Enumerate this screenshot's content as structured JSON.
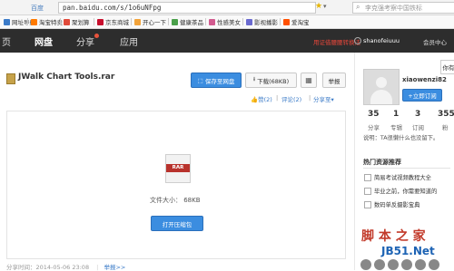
{
  "browser": {
    "brand": "百度",
    "url": "pan.baidu.com/s/1o6uNFpg",
    "search_placeholder": "李克强考察中国铁标"
  },
  "favorites": [
    {
      "label": "网址导航",
      "color": "#3b7bc8"
    },
    {
      "label": "淘宝特卖",
      "color": "#ff7a00"
    },
    {
      "label": "聚划算",
      "color": "#e04a3a"
    },
    {
      "label": "京东商城",
      "color": "#c8102e"
    },
    {
      "label": "开心一下",
      "color": "#f2a33a"
    },
    {
      "label": "健康茶品",
      "color": "#4aa04a"
    },
    {
      "label": "性感美女",
      "color": "#d25b8f"
    },
    {
      "label": "影视播影",
      "color": "#6a6ad0"
    },
    {
      "label": "爱淘宝",
      "color": "#ff5000"
    }
  ],
  "nav": {
    "home": "页",
    "pan": "网盘",
    "share": "分享",
    "apps": "应用",
    "promo": "用证借腰腰转换法",
    "user": "shanofeiuuu",
    "member": "会员中心"
  },
  "file": {
    "name": "JWalk Chart Tools.rar",
    "save_label": "保存至网盘",
    "download_label": "下载(68KB)",
    "report_label": "举报",
    "like_label": "赞(2)",
    "comment_label": "评论(2)",
    "shareto_label": "分享至",
    "size_label": "文件大小：  68KB",
    "open_label": "打开压缩包",
    "rar_text": "RAR",
    "share_time": "分享时间：2014-05-06 23:08",
    "report_link": "举报>>"
  },
  "sidebar": {
    "tooltip": "你有",
    "username": "xiaowenzi82",
    "subscribe_label": "+立即订阅",
    "stats": [
      {
        "num": "35",
        "label": "分享"
      },
      {
        "num": "1",
        "label": "专辑"
      },
      {
        "num": "3",
        "label": "订阅"
      },
      {
        "num": "355",
        "label": "粉"
      }
    ],
    "note": "说明：TA很懒什么也没留下。",
    "hot_title": "热门资源推荐",
    "hot_items": [
      "简易考试视频教程大全",
      "毕业之前，你需要知道的",
      "数码单反摄影宝典"
    ]
  },
  "watermark": {
    "line1": "脚 本 之 家",
    "line2": "JB51.Net"
  },
  "colors": {
    "nav_bg": "#2d2d2d",
    "accent": "#3b8de0",
    "promo": "#e2463a"
  }
}
